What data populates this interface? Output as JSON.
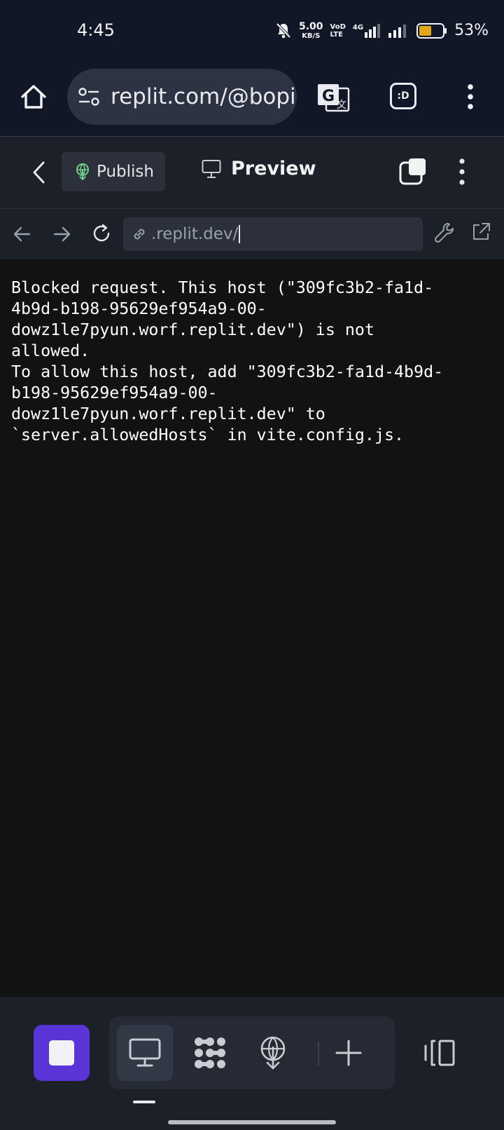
{
  "status_bar": {
    "time": "4:45",
    "net_speed_value": "5.00",
    "net_speed_unit": "KB/S",
    "volte_top": "VoD",
    "volte_bottom": "LTE",
    "network_type": "4G",
    "battery_percent": "53%",
    "battery_level": 0.53,
    "battery_color": "#e0a818"
  },
  "browser": {
    "url": "replit.com/@bopi",
    "extension_label": ":D"
  },
  "replit_header": {
    "publish_label": "Publish",
    "preview_label": "Preview"
  },
  "webview_nav": {
    "address": ".replit.dev/"
  },
  "content": {
    "message": "Blocked request. This host (\"309fc3b2-fa1d-\n4b9d-b198-95629ef954a9-00-\ndowz1le7pyun.worf.replit.dev\") is not\nallowed.\nTo allow this host, add \"309fc3b2-fa1d-4b9d-\nb198-95629ef954a9-00-\ndowz1le7pyun.worf.replit.dev\" to\n`server.allowedHosts` in vite.config.js."
  },
  "bottom_bar": {
    "stop_color": "#5b34d8",
    "icons": [
      "stop-icon",
      "monitor-icon",
      "dots-grid-icon",
      "deploy-icon",
      "plus-icon",
      "layout-toggle-icon"
    ]
  }
}
